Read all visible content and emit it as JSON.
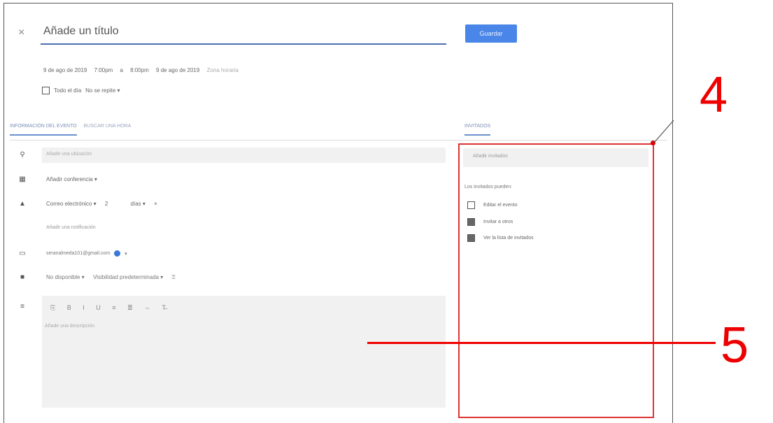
{
  "editor": {
    "close_icon": "×",
    "title_placeholder": "Añade un título",
    "save_label": "Guardar",
    "start_date": "9 de ago de 2019",
    "start_time": "7:00pm",
    "separator": "a",
    "end_time": "8:00pm",
    "end_date": "9 de ago de 2019",
    "timezone": "Zona horaria",
    "all_day_label": "Todo el día",
    "repeat_label": "No se repite ▾"
  },
  "tabs": {
    "details": "INFORMACIÓN DEL EVENTO",
    "find_time": "BUSCAR UNA HORA",
    "guests": "INVITADOS"
  },
  "details": {
    "location_placeholder": "Añade una ubicación",
    "conference_label": "Añadir conferencia ▾",
    "notification_type": "Correo electrónico ▾",
    "notification_value": "2",
    "notification_unit": "días ▾",
    "notification_remove": "×",
    "add_notification": "Añadir una notificación",
    "calendar_email": "seranalmeda101@gmail.com",
    "availability": "No disponible ▾",
    "visibility": "Visibilidad predeterminada ▾",
    "description_placeholder": "Añade una descripción",
    "toolbar": [
      "⎘",
      "B",
      "I",
      "U",
      "≡",
      "≣",
      "⇔",
      "T̶"
    ]
  },
  "guests": {
    "input_placeholder": "Añadir invitados",
    "permissions_heading": "Los invitados pueden:",
    "permissions": [
      {
        "label": "Editar el evento",
        "checked": false
      },
      {
        "label": "Invitar a otros",
        "checked": true
      },
      {
        "label": "Ver la lista de invitados",
        "checked": true
      }
    ]
  },
  "annotations": {
    "label_4": "4",
    "label_5": "5"
  },
  "colors": {
    "accent": "#4a86e8",
    "annotation_red": "#e00000"
  }
}
